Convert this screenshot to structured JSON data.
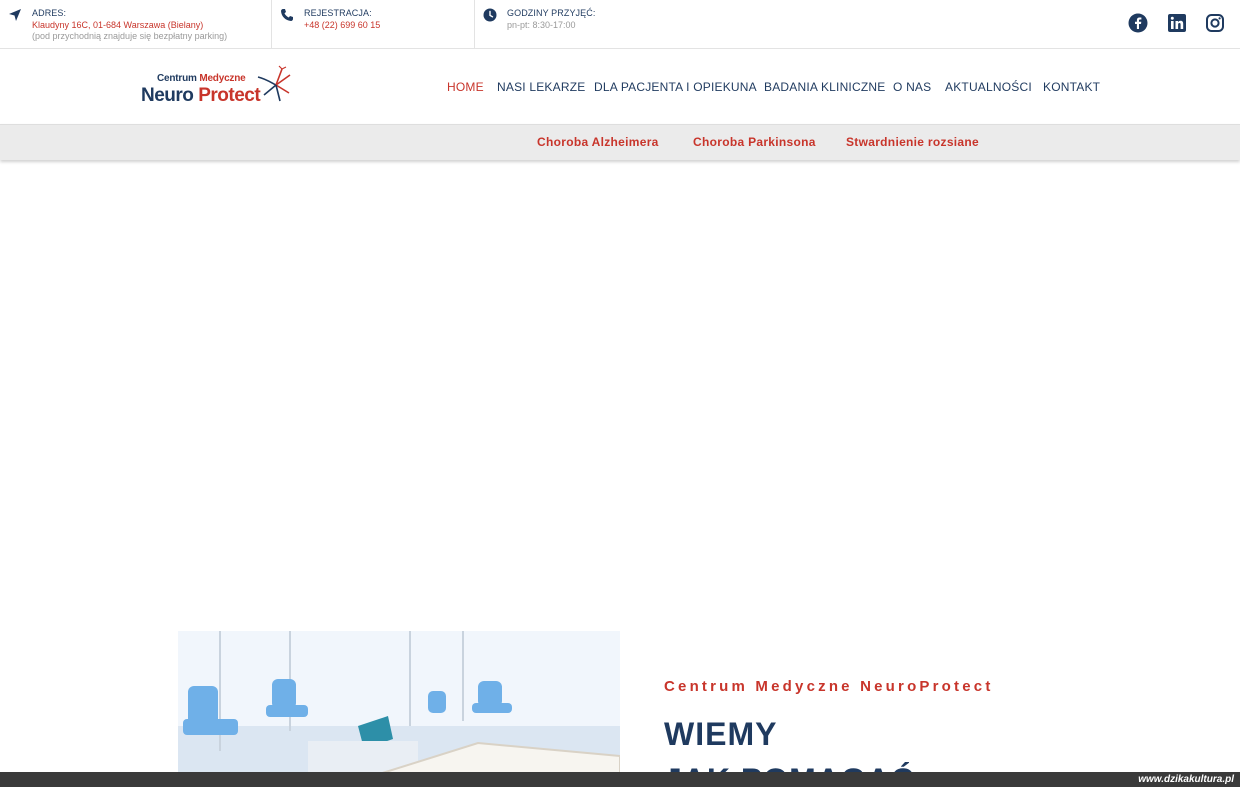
{
  "topbar": {
    "address": {
      "icon": "location-arrow-icon",
      "label": "ADRES:",
      "value": "Klaudyny 16C, 01-684 Warszawa (Bielany)",
      "note": "(pod przychodnią znajduje się bezpłatny parking)"
    },
    "registration": {
      "icon": "phone-icon",
      "label": "REJESTRACJA:",
      "value": "+48 (22) 699 60 15"
    },
    "hours": {
      "icon": "clock-icon",
      "label": "GODZINY PRZYJĘĆ:",
      "value": "pn-pt: 8:30-17:00"
    },
    "social": [
      "facebook-icon",
      "linkedin-icon",
      "instagram-icon"
    ]
  },
  "logo": {
    "line1_a": "Centrum",
    "line1_b": "Medyczne",
    "line2_a": "Neuro",
    "line2_b": "Protect"
  },
  "nav": {
    "items": [
      {
        "label": "HOME",
        "active": true
      },
      {
        "label": "NASI LEKARZE"
      },
      {
        "label": "DLA PACJENTA I OPIEKUNA"
      },
      {
        "label": "BADANIA KLINICZNE"
      },
      {
        "label": "O NAS"
      },
      {
        "label": "AKTUALNOŚCI"
      },
      {
        "label": "KONTAKT"
      }
    ]
  },
  "subnav": {
    "items": [
      "Choroba Alzheimera",
      "Choroba Parkinsona",
      "Stwardnienie rozsiane"
    ]
  },
  "hero": {
    "kicker": "Centrum Medyczne NeuroProtect",
    "headline_1": "WIEMY",
    "headline_2": "JAK POMAGAĆ"
  },
  "watermark": "www.dzikakultura.pl",
  "colors": {
    "navy": "#1f3a5f",
    "accent_red": "#c8352b",
    "chair_blue": "#6fb0e8"
  }
}
